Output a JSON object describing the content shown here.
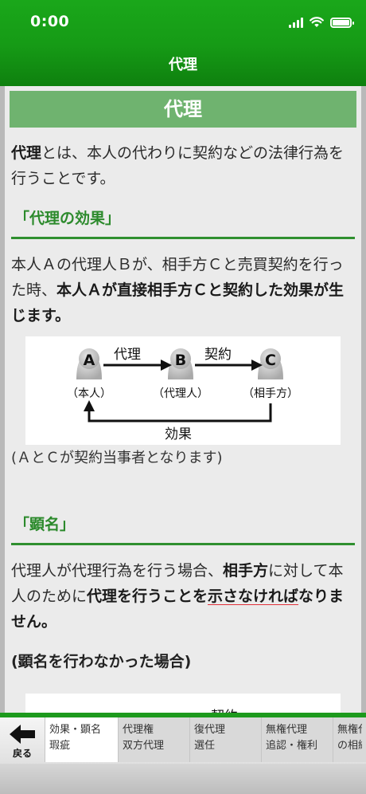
{
  "status": {
    "time": "0:00"
  },
  "nav": {
    "title": "代理"
  },
  "section": {
    "title": "代理"
  },
  "intro": {
    "term": "代理",
    "rest": "とは、本人の代わりに契約などの法律行為を行うことです。"
  },
  "effect": {
    "heading": "「代理の効果」",
    "p1": "本人Ａの代理人Ｂが、相手方Ｃと売買契約を行った時、",
    "p1_bold": "本人Ａが直接相手方Ｃと契約した効果が生じます。",
    "note": "(ＡとＣが契約当事者となります)"
  },
  "diagram": {
    "nodes": [
      {
        "letter": "A",
        "label": "（本人）"
      },
      {
        "letter": "B",
        "label": "（代理人）"
      },
      {
        "letter": "C",
        "label": "（相手方）"
      }
    ],
    "arrow_ab": "代理",
    "arrow_bc": "契約",
    "arrow_back": "効果"
  },
  "kenmei": {
    "heading": "「顕名」",
    "t1": "代理人が代理行為を行う場合、",
    "b1": "相手方",
    "t2": "に対して本人のために",
    "b2": "代理を行うことを",
    "b3": "示さなければ",
    "t3": "なりません。",
    "sub": "(顕名を行わなかった場合)"
  },
  "diagram2": {
    "label": "契約"
  },
  "bottom": {
    "back_label": "戻る",
    "tabs": [
      {
        "line1": "効果・顕名",
        "line2": "瑕疵"
      },
      {
        "line1": "代理権",
        "line2": "双方代理"
      },
      {
        "line1": "復代理",
        "line2": "選任"
      },
      {
        "line1": "無権代理",
        "line2": "追認・権利"
      },
      {
        "line1": "無権代",
        "line2": "の相続"
      }
    ]
  },
  "colors": {
    "nav_green": "#169b16",
    "header_green": "#6fb36f",
    "heading_green": "#2c8a2c",
    "underline_red": "#e0303a"
  }
}
